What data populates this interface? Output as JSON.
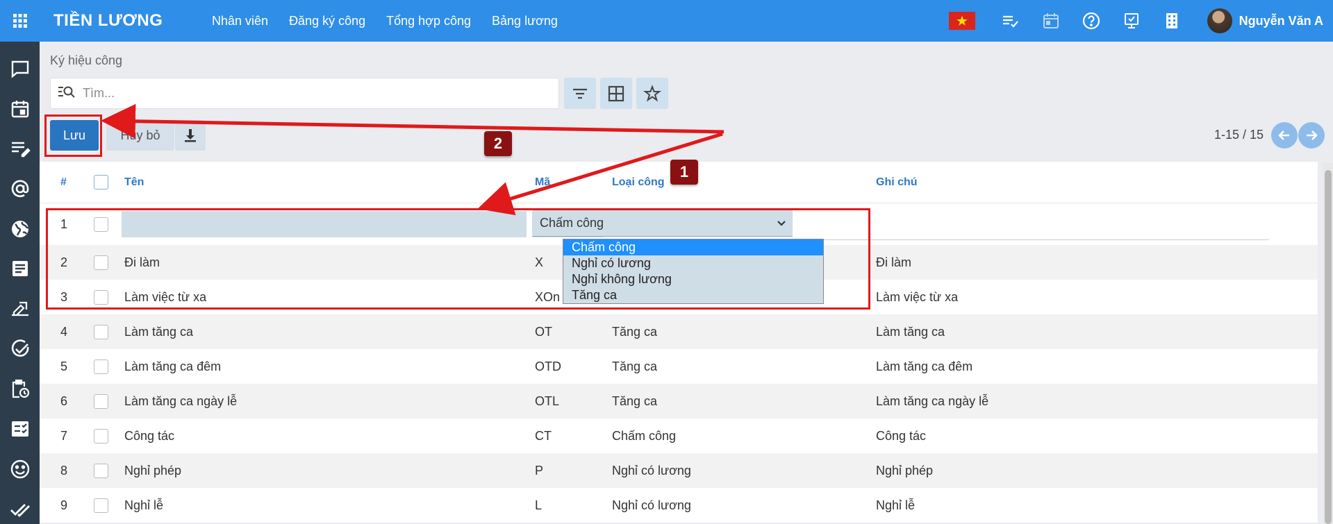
{
  "header": {
    "app_title": "TIỀN LƯƠNG",
    "nav": [
      "Nhân viên",
      "Đăng ký công",
      "Tổng hợp công",
      "Bảng lương"
    ],
    "user_name": "Nguyễn Văn A",
    "icons": [
      "apps-grid-icon",
      "vietnam-flag-icon",
      "task-list-icon",
      "calendar-icon",
      "help-icon",
      "approval-icon",
      "building-icon"
    ]
  },
  "sidebar": {
    "icons": [
      "chat-icon",
      "calendar-icon",
      "notes-icon",
      "at-sign-icon",
      "globe-icon",
      "document-icon",
      "sign-icon",
      "check-circle-icon",
      "clipboard-clock-icon",
      "checklist-icon",
      "smiley-icon",
      "double-check-icon"
    ]
  },
  "page": {
    "breadcrumb": "Ký hiệu công",
    "search_placeholder": "Tìm...",
    "save_label": "Lưu",
    "cancel_label": "Hủy bỏ",
    "pager_text": "1-15 / 15"
  },
  "table": {
    "columns": {
      "num": "#",
      "ten": "Tên",
      "ma": "Mã",
      "loai": "Loại công",
      "ghi": "Ghi chú"
    },
    "edit_row": {
      "num": "1",
      "loai": "Chấm công"
    },
    "rows": [
      {
        "num": "2",
        "ten": "Đi làm",
        "ma": "X",
        "loai": "",
        "ghi": "Đi làm"
      },
      {
        "num": "3",
        "ten": "Làm việc từ xa",
        "ma": "XOn",
        "loai": "",
        "ghi": "Làm việc từ xa"
      },
      {
        "num": "4",
        "ten": "Làm tăng ca",
        "ma": "OT",
        "loai": "Tăng ca",
        "ghi": "Làm tăng ca"
      },
      {
        "num": "5",
        "ten": "Làm tăng ca đêm",
        "ma": "OTD",
        "loai": "Tăng ca",
        "ghi": "Làm tăng ca đêm"
      },
      {
        "num": "6",
        "ten": "Làm tăng ca ngày lễ",
        "ma": "OTL",
        "loai": "Tăng ca",
        "ghi": "Làm tăng ca ngày lễ"
      },
      {
        "num": "7",
        "ten": "Công tác",
        "ma": "CT",
        "loai": "Chấm công",
        "ghi": "Công tác"
      },
      {
        "num": "8",
        "ten": "Nghỉ phép",
        "ma": "P",
        "loai": "Nghỉ có lương",
        "ghi": "Nghỉ phép"
      },
      {
        "num": "9",
        "ten": "Nghỉ lễ",
        "ma": "L",
        "loai": "Nghỉ có lương",
        "ghi": "Nghỉ lễ"
      }
    ]
  },
  "dropdown": {
    "options": [
      "Chấm công",
      "Nghỉ có lương",
      "Nghỉ không lương",
      "Tăng ca"
    ],
    "selected": "Chấm công"
  },
  "annotations": {
    "badge_1": "1",
    "badge_2": "2"
  },
  "colors": {
    "topbar": "#2f8ee8",
    "sidebar": "#2e3d4b",
    "primary_button": "#2a75c0",
    "annotation_red": "#e0191b",
    "badge": "#8a1111"
  }
}
